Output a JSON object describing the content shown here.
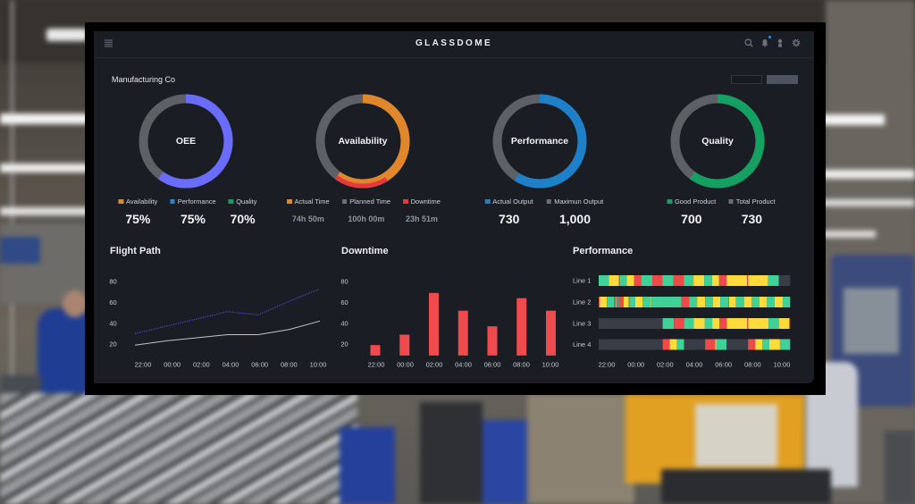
{
  "header": {
    "title": "GLASSDOME",
    "icons": [
      "menu-icon",
      "search-icon",
      "bell-icon",
      "user-icon",
      "gear-icon"
    ],
    "notification_dot": true
  },
  "page": {
    "company": "Manufacturing Co"
  },
  "colors": {
    "panel": "#1a1e24",
    "track": "#5d6166",
    "text": "#e8eaed"
  },
  "gauges": [
    {
      "label": "OEE",
      "fill": 0.6,
      "color": "#6a6cfd",
      "legend": [
        {
          "label": "Availability",
          "value": "75%",
          "color": "#e0862b"
        },
        {
          "label": "Performance",
          "value": "75%",
          "color": "#2288d6"
        },
        {
          "label": "Quality",
          "value": "70%",
          "color": "#16a05f"
        }
      ]
    },
    {
      "label": "Availability",
      "fill": 0.6,
      "color": "#e0862b",
      "overlay": {
        "from": 0.41,
        "to": 0.6,
        "color": "#e8383d"
      },
      "legend": [
        {
          "label": "Actual Time",
          "value": "74h 50m",
          "color": "#e0862b"
        },
        {
          "label": "Planned Time",
          "value": "100h 00m",
          "color": "#6b6f75"
        },
        {
          "label": "Downtime",
          "value": "23h 51m",
          "color": "#e8383d"
        }
      ]
    },
    {
      "label": "Performance",
      "fill": 0.59,
      "color": "#1d80c9",
      "legend": [
        {
          "label": "Actual Output",
          "value": "730",
          "color": "#1d80c9"
        },
        {
          "label": "Maximun Output",
          "value": "1,000",
          "color": "#6b6f75"
        }
      ]
    },
    {
      "label": "Quality",
      "fill": 0.6,
      "color": "#13a061",
      "legend": [
        {
          "label": "Good Product",
          "value": "700",
          "color": "#13a061"
        },
        {
          "label": "Total Product",
          "value": "730",
          "color": "#6b6f75"
        }
      ]
    }
  ],
  "chart_data": [
    {
      "type": "line",
      "title": "Flight Path",
      "x": [
        "22:00",
        "00:00",
        "02:00",
        "04:00",
        "06:00",
        "08:00",
        "10:00"
      ],
      "yticks": [
        20,
        40,
        60,
        80
      ],
      "ylim": [
        9,
        80
      ],
      "xlabel": "",
      "ylabel": "",
      "grid": false,
      "legend": "none",
      "series": [
        {
          "style": "dotted",
          "color": "#4b4fd6",
          "values": [
            30,
            37,
            44,
            51,
            48,
            61,
            73
          ]
        },
        {
          "style": "solid",
          "color": "#c4c4c4",
          "values": [
            19,
            23,
            26,
            29,
            29,
            34,
            42
          ]
        }
      ]
    },
    {
      "type": "bar",
      "title": "Downtime",
      "categories": [
        "22:00",
        "00:00",
        "02:00",
        "04:00",
        "06:00",
        "08:00",
        "10:00"
      ],
      "values": [
        19,
        29,
        69,
        52,
        37,
        64,
        52
      ],
      "yticks": [
        20,
        40,
        60,
        80
      ],
      "ylim": [
        9,
        80
      ],
      "color": "#ef4a4d",
      "xlabel": "",
      "ylabel": "",
      "grid": false
    },
    {
      "type": "bar",
      "orientation": "horizontal",
      "stacked": true,
      "title": "Performance",
      "categories": [
        "Line 1",
        "Line 2",
        "Line 3",
        "Line 4"
      ],
      "x": [
        "22:00",
        "00:00",
        "02:00",
        "04:00",
        "06:00",
        "08:00",
        "10:00"
      ],
      "segment_units": "percent of timeline",
      "state_colors": {
        "green": "#41d096",
        "yellow": "#fcdb3a",
        "red": "#ee4a4a",
        "gray": "#393d45"
      },
      "rows": [
        {
          "name": "Line 1",
          "segments": [
            [
              0,
              5.3,
              "green"
            ],
            [
              5.3,
              10.6,
              "yellow"
            ],
            [
              10.6,
              11.0,
              "red"
            ],
            [
              11.0,
              14.6,
              "green"
            ],
            [
              14.6,
              18.5,
              "yellow"
            ],
            [
              18.5,
              22.2,
              "red"
            ],
            [
              22.2,
              28.0,
              "green"
            ],
            [
              28.0,
              33.2,
              "red"
            ],
            [
              33.2,
              39.0,
              "green"
            ],
            [
              39.0,
              44.4,
              "red"
            ],
            [
              44.4,
              49.5,
              "green"
            ],
            [
              49.5,
              55.1,
              "yellow"
            ],
            [
              55.1,
              59.2,
              "green"
            ],
            [
              59.2,
              62.9,
              "yellow"
            ],
            [
              62.9,
              66.8,
              "red"
            ],
            [
              66.8,
              77.5,
              "yellow"
            ],
            [
              77.5,
              78.0,
              "red"
            ],
            [
              78.0,
              88.5,
              "yellow"
            ],
            [
              88.5,
              94.1,
              "green"
            ],
            [
              94.1,
              100,
              "gray"
            ]
          ]
        },
        {
          "name": "Line 2",
          "segments": [
            [
              0,
              0.5,
              "red"
            ],
            [
              0.5,
              4.3,
              "yellow"
            ],
            [
              4.3,
              8.1,
              "green"
            ],
            [
              8.1,
              8.7,
              "red"
            ],
            [
              8.7,
              9.6,
              "green"
            ],
            [
              9.6,
              10.2,
              "red"
            ],
            [
              10.2,
              10.6,
              "green"
            ],
            [
              10.6,
              13.0,
              "red"
            ],
            [
              13.0,
              15.7,
              "yellow"
            ],
            [
              15.7,
              16.0,
              "red"
            ],
            [
              16.0,
              19.1,
              "green"
            ],
            [
              19.1,
              23.0,
              "yellow"
            ],
            [
              23.0,
              27.3,
              "green"
            ],
            [
              27.3,
              27.6,
              "yellow"
            ],
            [
              27.6,
              43.2,
              "green"
            ],
            [
              43.2,
              47.2,
              "red"
            ],
            [
              47.2,
              51.4,
              "green"
            ],
            [
              51.4,
              55.6,
              "yellow"
            ],
            [
              55.6,
              59.6,
              "green"
            ],
            [
              59.6,
              63.5,
              "yellow"
            ],
            [
              63.5,
              67.7,
              "green"
            ],
            [
              67.7,
              68.0,
              "red"
            ],
            [
              68.0,
              71.7,
              "yellow"
            ],
            [
              71.7,
              75.9,
              "green"
            ],
            [
              75.9,
              79.8,
              "yellow"
            ],
            [
              79.8,
              84.0,
              "green"
            ],
            [
              84.0,
              87.9,
              "yellow"
            ],
            [
              87.9,
              91.9,
              "green"
            ],
            [
              91.9,
              96.1,
              "yellow"
            ],
            [
              96.1,
              100,
              "green"
            ]
          ]
        },
        {
          "name": "Line 3",
          "segments": [
            [
              0,
              33.4,
              "gray"
            ],
            [
              33.4,
              39.3,
              "green"
            ],
            [
              39.3,
              44.6,
              "red"
            ],
            [
              44.6,
              49.7,
              "green"
            ],
            [
              49.7,
              55.3,
              "yellow"
            ],
            [
              55.3,
              59.3,
              "green"
            ],
            [
              59.3,
              63.0,
              "yellow"
            ],
            [
              63.0,
              66.9,
              "red"
            ],
            [
              66.9,
              77.6,
              "yellow"
            ],
            [
              77.6,
              78.1,
              "red"
            ],
            [
              78.1,
              88.7,
              "yellow"
            ],
            [
              88.7,
              94.1,
              "green"
            ],
            [
              94.1,
              99.5,
              "yellow"
            ],
            [
              99.5,
              100,
              "red"
            ]
          ]
        },
        {
          "name": "Line 4",
          "segments": [
            [
              0,
              33.4,
              "gray"
            ],
            [
              33.4,
              37.1,
              "red"
            ],
            [
              37.1,
              40.8,
              "yellow"
            ],
            [
              40.8,
              44.6,
              "green"
            ],
            [
              44.6,
              55.6,
              "gray"
            ],
            [
              55.6,
              60.9,
              "red"
            ],
            [
              60.9,
              61.5,
              "yellow"
            ],
            [
              61.5,
              66.8,
              "green"
            ],
            [
              66.8,
              78.0,
              "gray"
            ],
            [
              78.0,
              81.7,
              "red"
            ],
            [
              81.7,
              85.4,
              "yellow"
            ],
            [
              85.4,
              89.1,
              "green"
            ],
            [
              89.1,
              94.7,
              "yellow"
            ],
            [
              94.7,
              100,
              "green"
            ]
          ]
        }
      ]
    }
  ]
}
